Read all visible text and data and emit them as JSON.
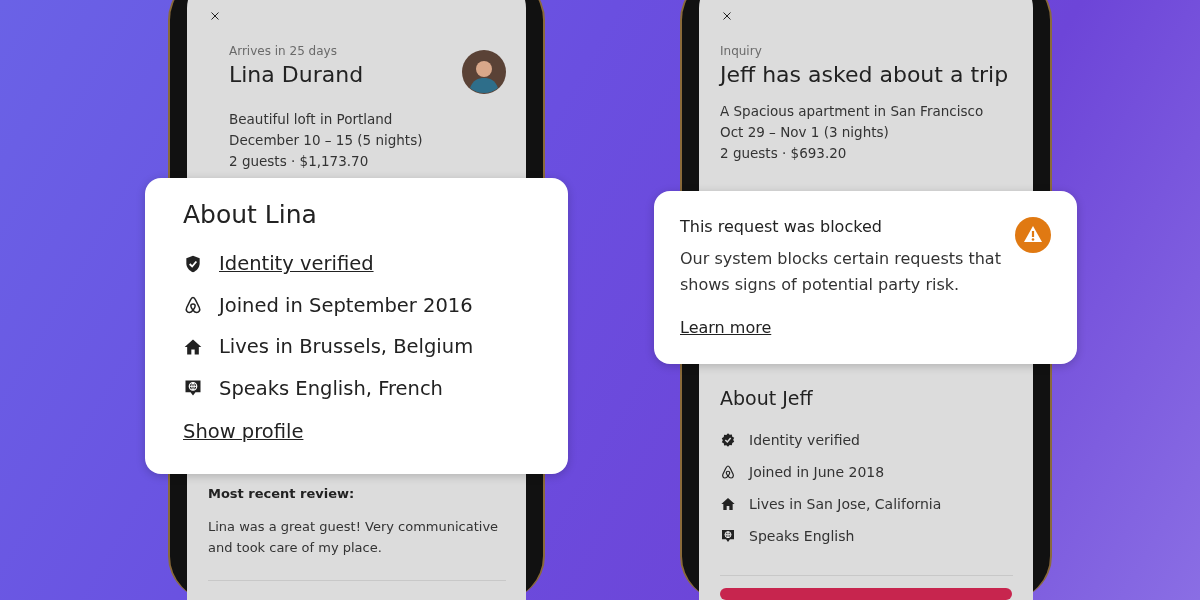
{
  "phones": [
    {
      "eyebrow": "Arrives in 25 days",
      "title": "Lina Durand",
      "avatar": true,
      "details": [
        "Beautiful loft in Portland",
        "December 10 – 15 (5 nights)",
        "2 guests · $1,173.70"
      ],
      "card": {
        "kind": "about",
        "title": "About Lina",
        "items": [
          {
            "kind": "verified",
            "text": "Identity verified",
            "link": true
          },
          {
            "kind": "joined",
            "text": "Joined in September 2016",
            "link": false
          },
          {
            "kind": "home",
            "text": "Lives in Brussels, Belgium",
            "link": false
          },
          {
            "kind": "languages",
            "text": "Speaks English, French",
            "link": false
          }
        ],
        "link": "Show profile"
      },
      "below": {
        "kind": "review",
        "heading": "Most recent review:",
        "text": "Lina was a great guest! Very communicative and took care of my place."
      },
      "action_button": false
    },
    {
      "eyebrow": "Inquiry",
      "title": "Jeff has asked about a trip",
      "avatar": false,
      "details": [
        "A Spacious apartment in San Francisco",
        "Oct 29 – Nov 1 (3 nights)",
        "2 guests · $693.20"
      ],
      "card": {
        "kind": "alert",
        "title": "This request was blocked",
        "body": "Our system blocks certain requests that shows signs of potential party risk.",
        "link": "Learn more"
      },
      "below": {
        "kind": "about",
        "title": "About Jeff",
        "items": [
          {
            "kind": "verified",
            "text": "Identity verified",
            "link": false
          },
          {
            "kind": "joined",
            "text": "Joined in June 2018",
            "link": false
          },
          {
            "kind": "home",
            "text": "Lives in San Jose, California",
            "link": false
          },
          {
            "kind": "languages",
            "text": "Speaks English",
            "link": false
          }
        ]
      },
      "action_button": true
    }
  ]
}
